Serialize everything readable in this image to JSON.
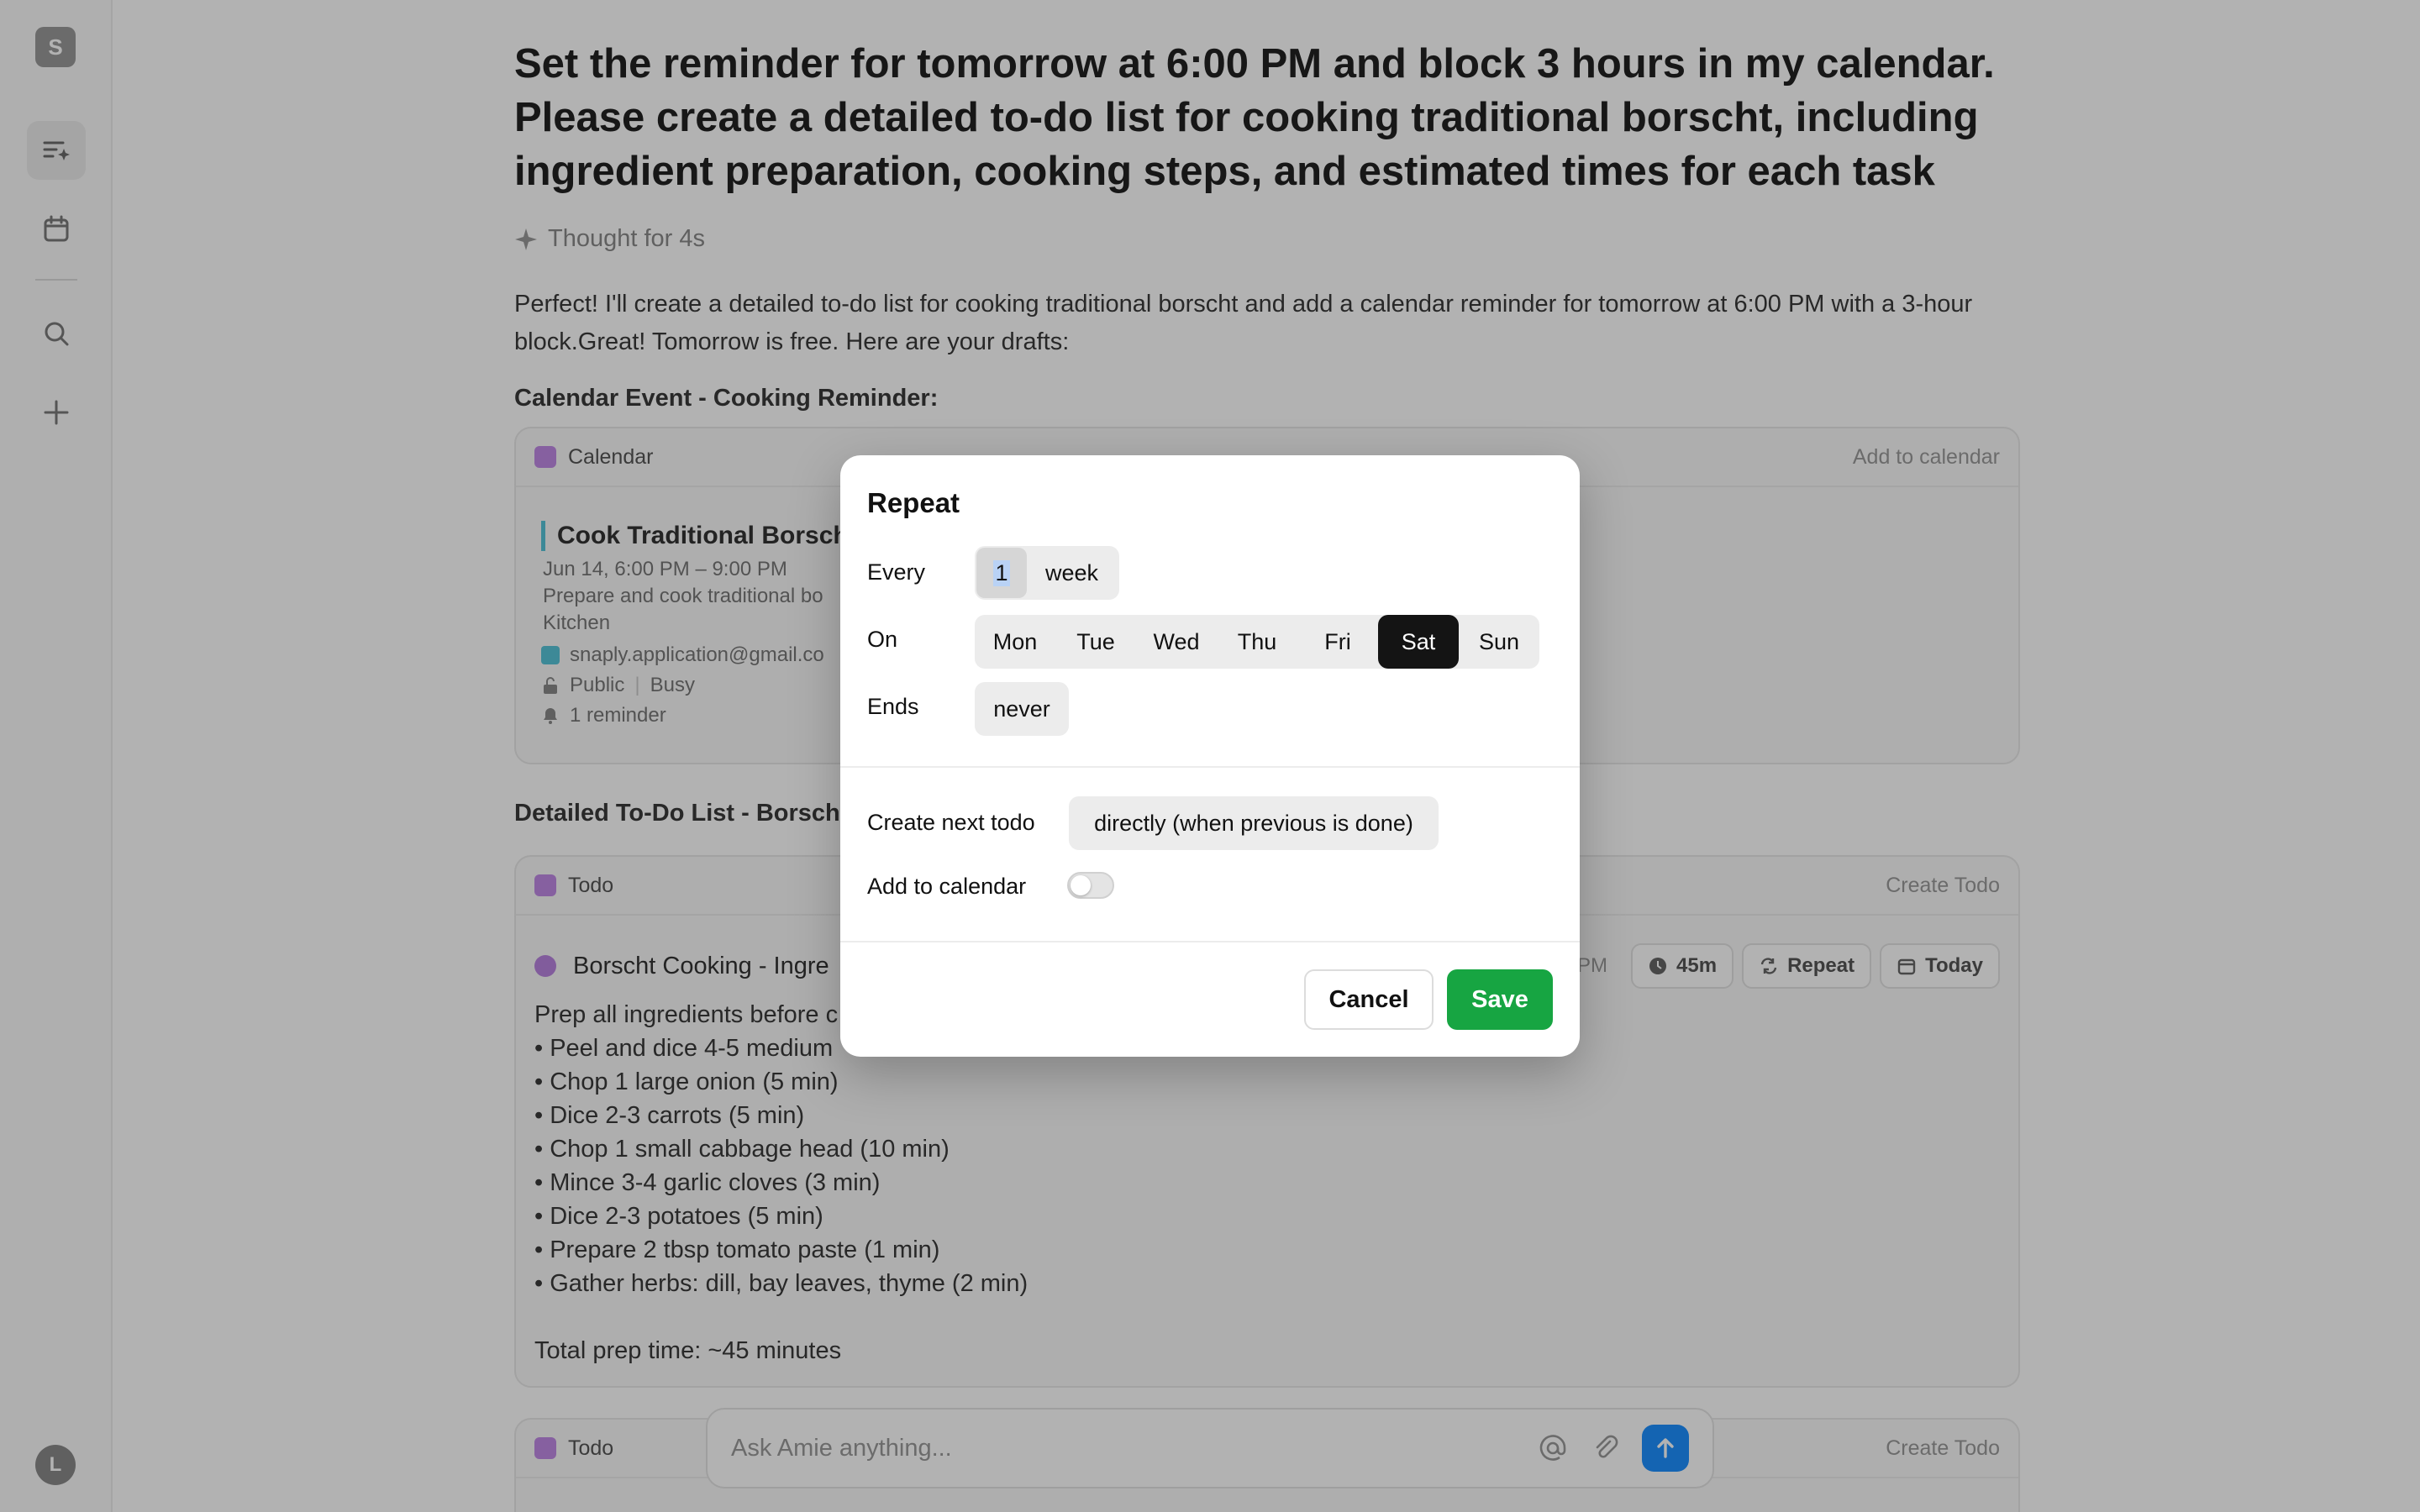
{
  "sidebar": {
    "workspace_initial": "S",
    "user_initial": "L"
  },
  "chat": {
    "prompt": "Set the reminder for tomorrow at 6:00 PM and block 3 hours in my calendar. Please create a detailed to-do list for cooking traditional borscht, including ingredient preparation, cooking steps, and estimated times for each task",
    "thought": "Thought for 4s",
    "answer": "Perfect! I'll create a detailed to-do list for cooking traditional borscht and add a calendar reminder for tomorrow at 6:00 PM with a 3-hour block.Great! Tomorrow is free. Here are your drafts:",
    "section_calendar": "Calendar Event - Cooking Reminder:",
    "section_todo": "Detailed To-Do List - Borscht"
  },
  "calendar_card": {
    "tag": "Calendar",
    "action": "Add to calendar",
    "event_title": "Cook Traditional Borscht",
    "event_time": "Jun 14, 6:00 PM – 9:00 PM",
    "event_desc": "Prepare and cook traditional bo",
    "event_location": "Kitchen",
    "event_calendar": "snaply.application@gmail.co",
    "visibility": "Public",
    "availability": "Busy",
    "reminders": "1 reminder"
  },
  "todo_card": {
    "tag": "Todo",
    "action": "Create Todo",
    "title": "Borscht Cooking - Ingre",
    "pill_time_partial": "PM",
    "pill_duration": "45m",
    "pill_repeat": "Repeat",
    "pill_date": "Today",
    "body_lines": [
      "Prep all ingredients before c",
      "• Peel and dice 4-5 medium",
      "• Chop 1 large onion (5 min)",
      "• Dice 2-3 carrots (5 min)",
      "• Chop 1 small cabbage head (10 min)",
      "• Mince 3-4 garlic cloves (3 min)",
      "• Dice 2-3 potatoes (5 min)",
      "• Prepare 2 tbsp tomato paste (1 min)",
      "• Gather herbs: dill, bay leaves, thyme (2 min)",
      "",
      "Total prep time: ~45 minutes"
    ]
  },
  "todo_card_2": {
    "tag": "Todo",
    "action": "Create Todo"
  },
  "ask_bar": {
    "placeholder": "Ask Amie anything..."
  },
  "repeat_modal": {
    "title": "Repeat",
    "every_label": "Every",
    "every_value": "1",
    "every_unit": "week",
    "on_label": "On",
    "days": [
      "Mon",
      "Tue",
      "Wed",
      "Thu",
      "Fri",
      "Sat",
      "Sun"
    ],
    "selected_day": "Sat",
    "ends_label": "Ends",
    "ends_value": "never",
    "create_next_label": "Create next todo",
    "create_next_value": "directly (when previous is done)",
    "add_calendar_label": "Add to calendar",
    "add_calendar_enabled": false,
    "cancel_label": "Cancel",
    "save_label": "Save"
  },
  "colors": {
    "save_button": "#17a542",
    "selected_day": "#141414",
    "send_button": "#1e90ff",
    "tag_purple": "#c08ae6",
    "event_accent": "#58c4d8"
  }
}
